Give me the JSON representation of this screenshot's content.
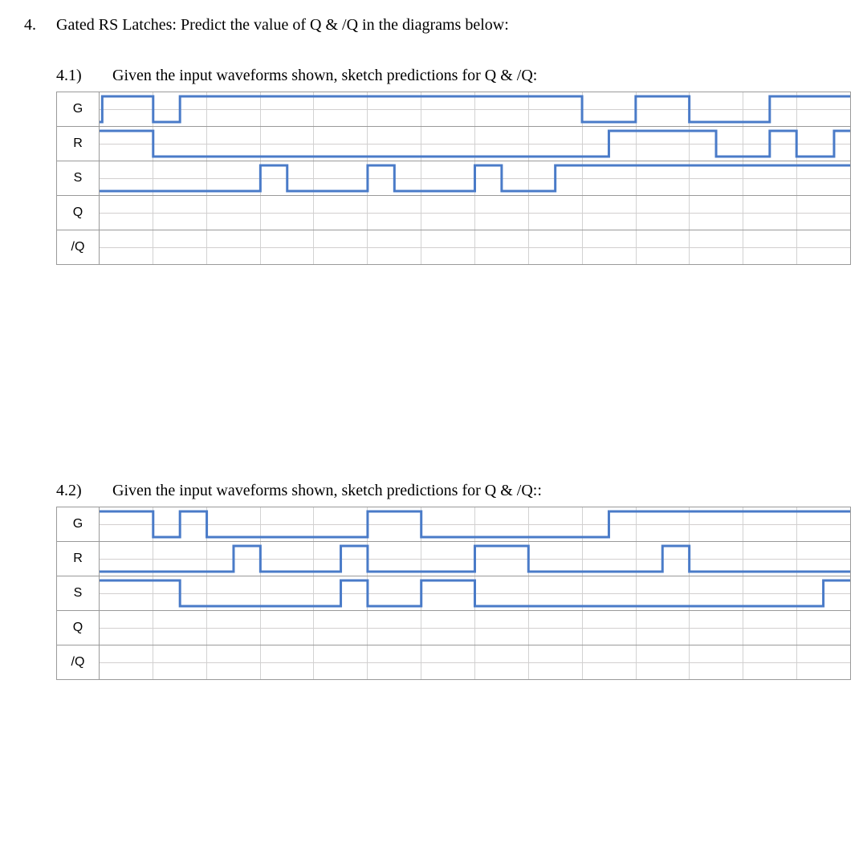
{
  "question": {
    "number": "4.",
    "text": "Gated RS Latches: Predict the value of Q & /Q in the diagrams below:"
  },
  "part1": {
    "number": "4.1)",
    "text": "Given the input waveforms shown, sketch predictions for Q & /Q:",
    "signals": [
      "G",
      "R",
      "S",
      "Q",
      "/Q"
    ],
    "cols": 14,
    "waves": {
      "G": [
        [
          0,
          0
        ],
        [
          0.05,
          0
        ],
        [
          0.05,
          1
        ],
        [
          1,
          1
        ],
        [
          1,
          0
        ],
        [
          1.5,
          0
        ],
        [
          1.5,
          1
        ],
        [
          9,
          1
        ],
        [
          9,
          0
        ],
        [
          10,
          0
        ],
        [
          10,
          1
        ],
        [
          11,
          1
        ],
        [
          11,
          0
        ],
        [
          12.5,
          0
        ],
        [
          12.5,
          1
        ],
        [
          14,
          1
        ]
      ],
      "R": [
        [
          0,
          1
        ],
        [
          1,
          1
        ],
        [
          1,
          0
        ],
        [
          9.5,
          0
        ],
        [
          9.5,
          1
        ],
        [
          11.5,
          1
        ],
        [
          11.5,
          0
        ],
        [
          12.5,
          0
        ],
        [
          12.5,
          1
        ],
        [
          13,
          1
        ],
        [
          13,
          0
        ],
        [
          13.7,
          0
        ],
        [
          13.7,
          1
        ],
        [
          14,
          1
        ]
      ],
      "S": [
        [
          0,
          0
        ],
        [
          3,
          0
        ],
        [
          3,
          1
        ],
        [
          3.5,
          1
        ],
        [
          3.5,
          0
        ],
        [
          5,
          0
        ],
        [
          5,
          1
        ],
        [
          5.5,
          1
        ],
        [
          5.5,
          0
        ],
        [
          7,
          0
        ],
        [
          7,
          1
        ],
        [
          7.5,
          1
        ],
        [
          7.5,
          0
        ],
        [
          8.5,
          0
        ],
        [
          8.5,
          1
        ],
        [
          14,
          1
        ]
      ],
      "Q": null,
      "/Q": null
    }
  },
  "part2": {
    "number": "4.2)",
    "text": "Given the input waveforms shown, sketch predictions for Q & /Q::",
    "signals": [
      "G",
      "R",
      "S",
      "Q",
      "/Q"
    ],
    "cols": 14,
    "waves": {
      "G": [
        [
          0,
          1
        ],
        [
          1,
          1
        ],
        [
          1,
          0
        ],
        [
          1.5,
          0
        ],
        [
          1.5,
          1
        ],
        [
          2,
          1
        ],
        [
          2,
          0
        ],
        [
          5,
          0
        ],
        [
          5,
          1
        ],
        [
          6,
          1
        ],
        [
          6,
          0
        ],
        [
          9.5,
          0
        ],
        [
          9.5,
          1
        ],
        [
          14,
          1
        ]
      ],
      "R": [
        [
          0,
          0
        ],
        [
          2.5,
          0
        ],
        [
          2.5,
          1
        ],
        [
          3,
          1
        ],
        [
          3,
          0
        ],
        [
          4.5,
          0
        ],
        [
          4.5,
          1
        ],
        [
          5,
          1
        ],
        [
          5,
          0
        ],
        [
          7,
          0
        ],
        [
          7,
          1
        ],
        [
          8,
          1
        ],
        [
          8,
          0
        ],
        [
          10.5,
          0
        ],
        [
          10.5,
          1
        ],
        [
          11,
          1
        ],
        [
          11,
          0
        ],
        [
          14,
          0
        ]
      ],
      "S": [
        [
          0,
          1
        ],
        [
          1.5,
          1
        ],
        [
          1.5,
          0
        ],
        [
          4.5,
          0
        ],
        [
          4.5,
          1
        ],
        [
          5,
          1
        ],
        [
          5,
          0
        ],
        [
          6,
          0
        ],
        [
          6,
          1
        ],
        [
          7,
          1
        ],
        [
          7,
          0
        ],
        [
          13.5,
          0
        ],
        [
          13.5,
          1
        ],
        [
          14,
          1
        ]
      ],
      "Q": null,
      "/Q": null
    }
  },
  "chart_data": [
    {
      "type": "timing",
      "title": "4.1 Gated RS Latch input waveforms",
      "time_divisions": 14,
      "signals": {
        "G": {
          "edges": [
            [
              0,
              0
            ],
            [
              0.05,
              1
            ],
            [
              1,
              0
            ],
            [
              1.5,
              1
            ],
            [
              9,
              0
            ],
            [
              10,
              1
            ],
            [
              11,
              0
            ],
            [
              12.5,
              1
            ]
          ],
          "end": 14
        },
        "R": {
          "edges": [
            [
              0,
              1
            ],
            [
              1,
              0
            ],
            [
              9.5,
              1
            ],
            [
              11.5,
              0
            ],
            [
              12.5,
              1
            ],
            [
              13,
              0
            ],
            [
              13.7,
              1
            ]
          ],
          "end": 14
        },
        "S": {
          "edges": [
            [
              0,
              0
            ],
            [
              3,
              1
            ],
            [
              3.5,
              0
            ],
            [
              5,
              1
            ],
            [
              5.5,
              0
            ],
            [
              7,
              1
            ],
            [
              7.5,
              0
            ],
            [
              8.5,
              1
            ]
          ],
          "end": 14
        },
        "Q": null,
        "/Q": null
      }
    },
    {
      "type": "timing",
      "title": "4.2 Gated RS Latch input waveforms",
      "time_divisions": 14,
      "signals": {
        "G": {
          "edges": [
            [
              0,
              1
            ],
            [
              1,
              0
            ],
            [
              1.5,
              1
            ],
            [
              2,
              0
            ],
            [
              5,
              1
            ],
            [
              6,
              0
            ],
            [
              9.5,
              1
            ]
          ],
          "end": 14
        },
        "R": {
          "edges": [
            [
              0,
              0
            ],
            [
              2.5,
              1
            ],
            [
              3,
              0
            ],
            [
              4.5,
              1
            ],
            [
              5,
              0
            ],
            [
              7,
              1
            ],
            [
              8,
              0
            ],
            [
              10.5,
              1
            ],
            [
              11,
              0
            ]
          ],
          "end": 14
        },
        "S": {
          "edges": [
            [
              0,
              1
            ],
            [
              1.5,
              0
            ],
            [
              4.5,
              1
            ],
            [
              5,
              0
            ],
            [
              6,
              1
            ],
            [
              7,
              0
            ],
            [
              13.5,
              1
            ]
          ],
          "end": 14
        },
        "Q": null,
        "/Q": null
      }
    }
  ]
}
